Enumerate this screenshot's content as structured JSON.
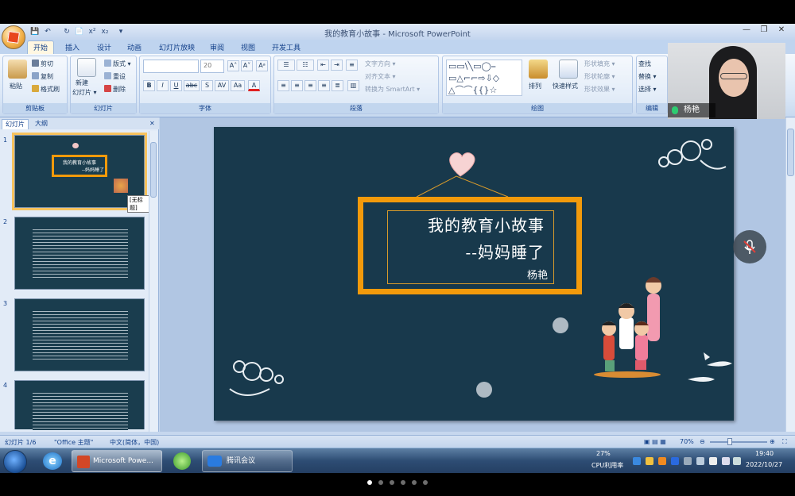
{
  "app": {
    "window_title": "我的教育小故事 - Microsoft PowerPoint",
    "quick_access": [
      "💾",
      "↶",
      "↻",
      "📄",
      "x²",
      "x₂",
      "▾"
    ],
    "window_controls": [
      "—",
      "❐",
      "✕"
    ]
  },
  "ribbon_tabs": [
    "开始",
    "插入",
    "设计",
    "动画",
    "幻灯片放映",
    "审阅",
    "视图",
    "开发工具"
  ],
  "clipboard": {
    "paste": "粘贴",
    "cut": "剪切",
    "copy": "复制",
    "format_painter": "格式刷",
    "label": "剪贴板"
  },
  "slides_group": {
    "new_slide": "新建",
    "new_slide2": "幻灯片 ▾",
    "layout": "版式 ▾",
    "reset": "重设",
    "delete": "删除",
    "label": "幻灯片"
  },
  "font_group": {
    "font_name": "",
    "font_size": "20",
    "grow": "A˄",
    "shrink": "A˅",
    "clear": "Aᵃ",
    "bold": "B",
    "italic": "I",
    "underline": "U",
    "strike": "abc",
    "shadow": "S",
    "spacing": "AV",
    "case": "Aa",
    "color": "A",
    "label": "字体"
  },
  "paragraph_group": {
    "text_direction": "文字方向 ▾",
    "align_text": "对齐文本 ▾",
    "smartart": "转换为 SmartArt ▾",
    "label": "段落"
  },
  "drawing_group": {
    "arrange": "排列",
    "quick_styles": "快速样式",
    "shape_fill": "形状填充 ▾",
    "shape_outline": "形状轮廓 ▾",
    "shape_effects": "形状效果 ▾",
    "label": "绘图"
  },
  "editing_group": {
    "find": "查找",
    "replace": "替换 ▾",
    "select": "选择 ▾",
    "label": "编辑"
  },
  "panel": {
    "tab_slides": "幻灯片",
    "tab_outline": "大纲",
    "close": "✕",
    "thumbs": [
      {
        "num": "1",
        "title": "我的教育小故事",
        "subtitle": "--妈妈睡了",
        "tooltip": "[无标题]"
      },
      {
        "num": "2"
      },
      {
        "num": "3"
      },
      {
        "num": "4"
      }
    ]
  },
  "slide": {
    "title": "我的教育小故事",
    "subtitle": "--妈妈睡了",
    "author": "杨艳"
  },
  "statusbar": {
    "slide_index": "幻灯片 1/6",
    "theme": "\"Office 主题\"",
    "language": "中文(简体，中国)",
    "zoom": "70%",
    "zoom_level": 0.7
  },
  "taskbar": {
    "ppt": "Microsoft Powe...",
    "meeting": "腾讯会议",
    "cpu_percent": "27%",
    "cpu_label": "CPU利用率",
    "time": "19:40",
    "date": "2022/10/27"
  },
  "video": {
    "participant": "杨艳"
  },
  "pager": {
    "count": 6,
    "active": 0
  },
  "colors": {
    "slide_bg": "#18394c",
    "frame": "#f29a0b",
    "ribbon_label": "#15428b"
  }
}
